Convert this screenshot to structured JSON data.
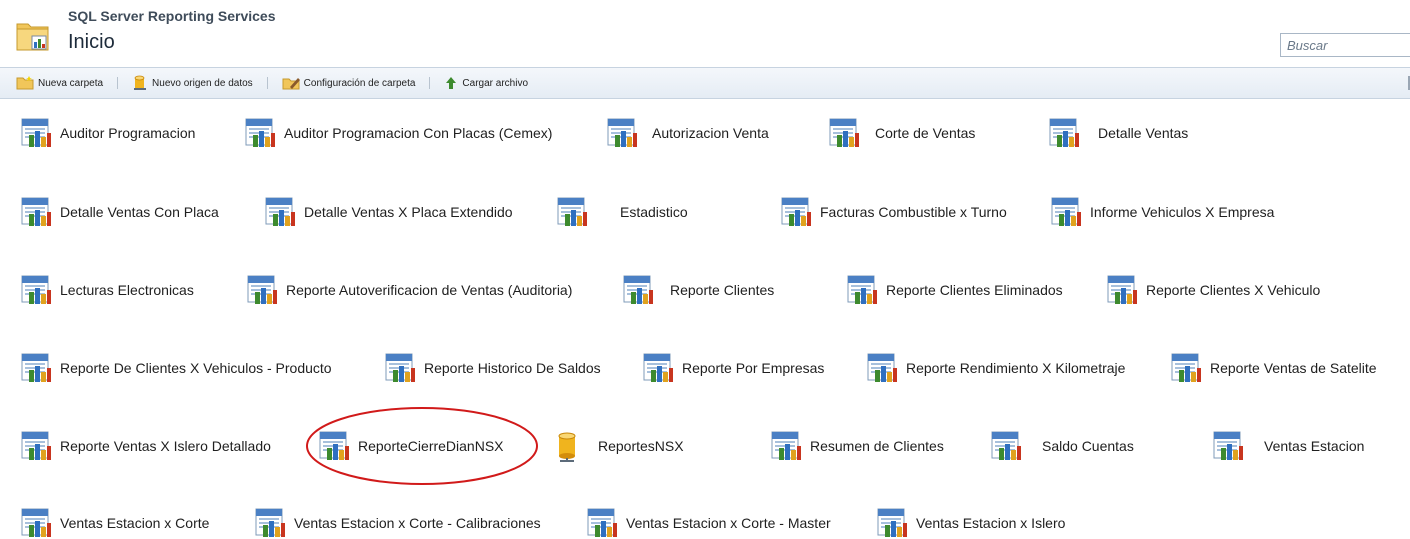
{
  "header": {
    "app_title": "SQL Server Reporting Services",
    "page_title": "Inicio",
    "search_placeholder": "Buscar"
  },
  "toolbar": {
    "new_folder": "Nueva carpeta",
    "new_datasource": "Nuevo origen de datos",
    "folder_settings": "Configuración de carpeta",
    "upload_file": "Cargar archivo"
  },
  "items": [
    "Auditor Programacion",
    "Auditor Programacion Con Placas (Cemex)",
    "Autorizacion Venta",
    "Corte de Ventas",
    "Detalle Ventas",
    "Detalle Ventas Con Placa",
    "Detalle Ventas X Placa Extendido",
    "Estadistico",
    "Facturas Combustible x Turno",
    "Informe Vehiculos X Empresa",
    "Lecturas Electronicas",
    "Reporte Autoverificacion de Ventas (Auditoria)",
    "Reporte Clientes",
    "Reporte Clientes Eliminados",
    "Reporte Clientes X Vehiculo",
    "Reporte De Clientes X Vehiculos - Producto",
    "Reporte Historico De Saldos",
    "Reporte Por Empresas",
    "Reporte Rendimiento X Kilometraje",
    "Reporte Ventas de Satelite",
    "Reporte Ventas X Islero Detallado",
    "ReporteCierreDianNSX",
    "ReportesNSX",
    "Resumen de Clientes",
    "Saldo Cuentas",
    "Ventas Estacion",
    "Ventas Estacion x Corte",
    "Ventas Estacion x Corte - Calibraciones",
    "Ventas Estacion x Corte - Master",
    "Ventas Estacion x Islero"
  ],
  "colors": {
    "highlight": "#d11a1a",
    "toolbar_border": "#c7d3e0"
  }
}
